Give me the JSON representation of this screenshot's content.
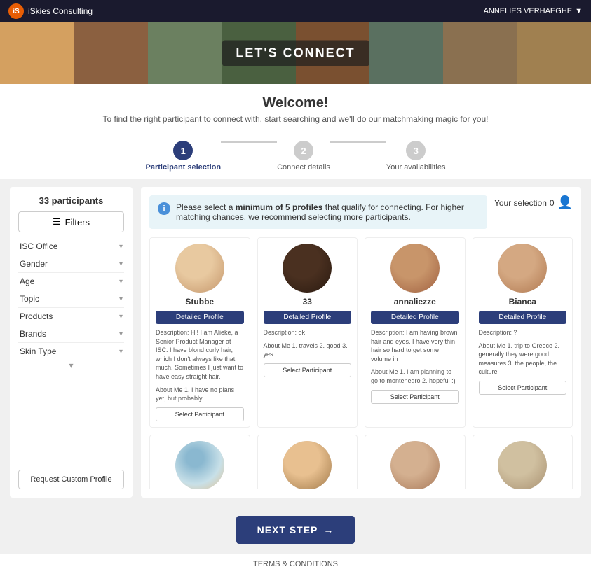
{
  "app": {
    "title": "iSkies Consulting",
    "user": "ANNELIES VERHAEGHE",
    "user_chevron": "▼"
  },
  "banner": {
    "text": "LET'S CONNECT"
  },
  "welcome": {
    "heading": "Welcome!",
    "subtext": "To find the right participant to connect with, start searching and we'll do our matchmaking magic for you!"
  },
  "stepper": {
    "steps": [
      {
        "number": "1",
        "label": "Participant selection",
        "state": "active"
      },
      {
        "number": "2",
        "label": "Connect details",
        "state": "inactive"
      },
      {
        "number": "3",
        "label": "Your availabilities",
        "state": "inactive"
      }
    ]
  },
  "sidebar": {
    "participants_count": "33 participants",
    "filters_label": "Filters",
    "filter_icon": "☰",
    "filters": [
      {
        "label": "ISC Office"
      },
      {
        "label": "Gender"
      },
      {
        "label": "Age"
      },
      {
        "label": "Topic"
      },
      {
        "label": "Products"
      },
      {
        "label": "Brands"
      },
      {
        "label": "Skin Type"
      }
    ],
    "custom_profile_btn": "Request Custom Profile"
  },
  "info_banner": {
    "icon": "i",
    "text_part1": "Please select a ",
    "text_bold": "minimum of 5 profiles",
    "text_part2": " that qualify for connecting. For higher matching chances, we recommend selecting more participants.",
    "selection_label": "Your selection",
    "selection_count": "0"
  },
  "participants": [
    {
      "name": "Stubbe",
      "avatar_class": "av1",
      "btn_label": "Detailed Profile",
      "description": "Description: Hi! I am Alieke, a Senior Product Manager at ISC. I have blond curly hair, which I don't always like that much. Sometimes I just want to have easy straight hair.",
      "about_me": "About Me\n1. I have no plans yet, but probably",
      "select_label": "Select Participant"
    },
    {
      "name": "33",
      "avatar_class": "av2",
      "btn_label": "Detailed Profile",
      "description": "Description: ok",
      "about_me": "About Me\n1. travels\n2. good\n3. yes",
      "select_label": "Select Participant"
    },
    {
      "name": "annaliezze",
      "avatar_class": "av3",
      "btn_label": "Detailed Profile",
      "description": "Description: I am having brown hair and eyes. I have very thin hair so hard to get some volume in",
      "about_me": "About Me\n1. I am planning to go to montenegro\n2. hopeful :)",
      "select_label": "Select Participant"
    },
    {
      "name": "Bianca",
      "avatar_class": "av4",
      "btn_label": "Detailed Profile",
      "description": "Description: ?",
      "about_me": "About Me\n1. trip to Greece\n2. generally they were good measures\n3. the people, the culture",
      "select_label": "Select Participant"
    },
    {
      "name": "",
      "avatar_class": "av5",
      "btn_label": "",
      "description": "",
      "about_me": "",
      "select_label": ""
    },
    {
      "name": "",
      "avatar_class": "av6",
      "btn_label": "",
      "description": "",
      "about_me": "",
      "select_label": ""
    },
    {
      "name": "",
      "avatar_class": "av7",
      "btn_label": "",
      "description": "",
      "about_me": "",
      "select_label": ""
    },
    {
      "name": "",
      "avatar_class": "av8",
      "btn_label": "",
      "description": "",
      "about_me": "",
      "select_label": ""
    }
  ],
  "next_step": {
    "label": "NEXT STEP",
    "arrow": "→"
  },
  "footer": {
    "label": "TERMS & CONDITIONS"
  }
}
